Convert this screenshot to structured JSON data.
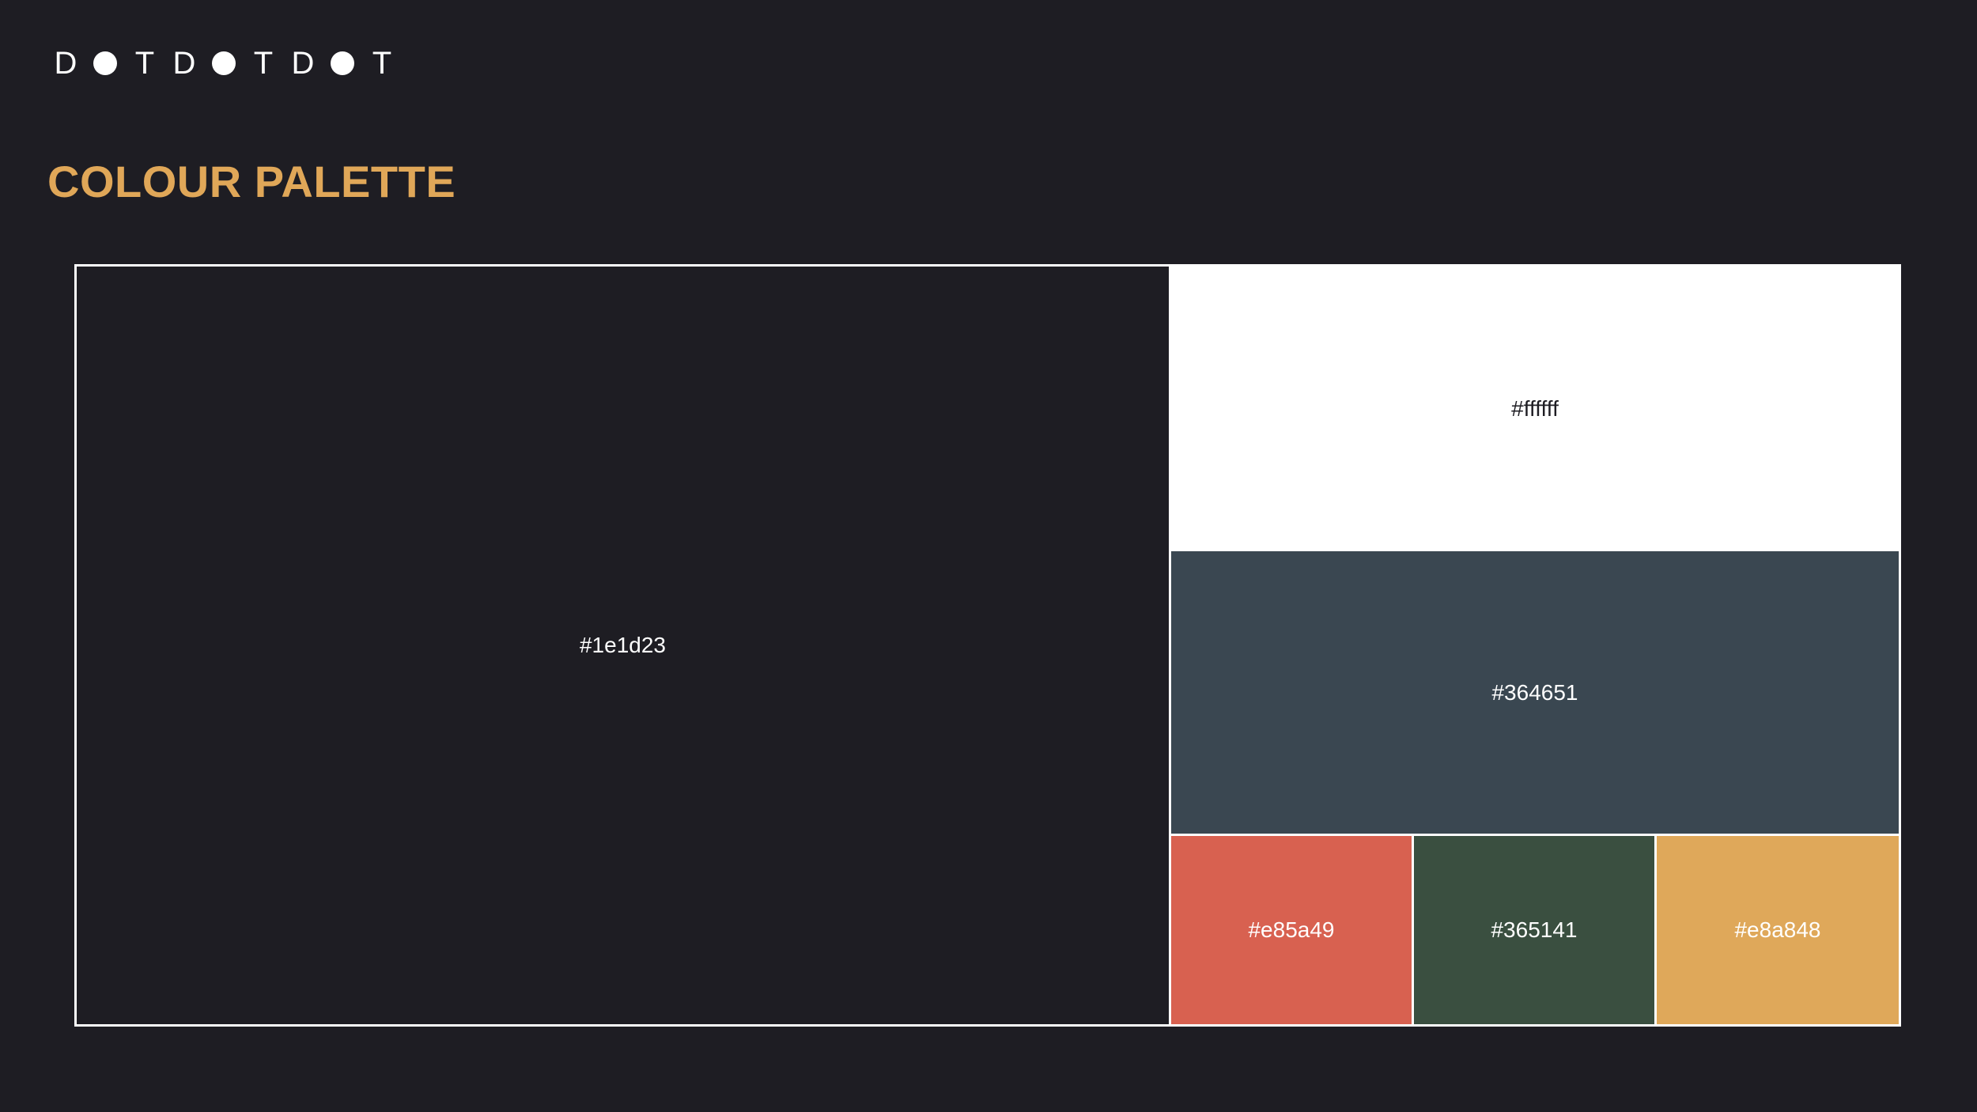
{
  "logo": {
    "letters": [
      "D",
      "",
      "T",
      "D",
      "",
      "T",
      "D",
      "",
      "T"
    ],
    "color": "#ffffff"
  },
  "title": {
    "text": "COLOUR PALETTE",
    "color": "#e0a758"
  },
  "palette": {
    "border_color": "#ffffff",
    "swatches": [
      {
        "hex": "#1e1d23",
        "fill": "#1e1d23",
        "text_color": "#ffffff"
      },
      {
        "hex": "#ffffff",
        "fill": "#ffffff",
        "text_color": "#1e1d23"
      },
      {
        "hex": "#364651",
        "fill": "#3a4751",
        "text_color": "#ffffff"
      },
      {
        "hex": "#e85a49",
        "fill": "#d86150",
        "text_color": "#ffffff"
      },
      {
        "hex": "#365141",
        "fill": "#3a4f40",
        "text_color": "#ffffff"
      },
      {
        "hex": "#e8a848",
        "fill": "#dfa85a",
        "text_color": "#ffffff"
      }
    ]
  }
}
